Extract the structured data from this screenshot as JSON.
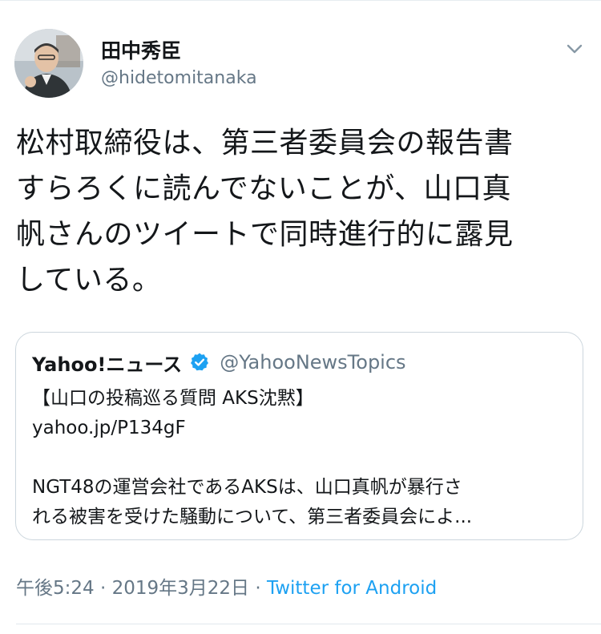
{
  "author": {
    "name": "田中秀臣",
    "handle": "@hidetomitanaka"
  },
  "tweet": {
    "lines": [
      "松村取締役は、第三者委員会の報告書",
      "すらろくに読んでないことが、山口真",
      "帆さんのツイートで同時進行的に露見",
      "している。"
    ]
  },
  "quote": {
    "name": "Yahoo!ニュース",
    "handle": "@YahooNewsTopics",
    "line1": "【山口の投稿巡る質問 AKS沈黙】",
    "link": "yahoo.jp/P134gF",
    "line3": "NGT48の運営会社であるAKSは、山口真帆が暴行さ",
    "line4": "れる被害を受けた騒動について、第三者委員会によ..."
  },
  "meta": {
    "time": "午後5:24",
    "separator1": " · ",
    "date": "2019年3月22日",
    "separator2": " · ",
    "app": "Twitter for Android"
  },
  "icons": {
    "more": "chevron-down-icon",
    "verified": "verified-badge-icon"
  },
  "colors": {
    "accent": "#1da1f2",
    "secondary_text": "#657786",
    "border": "#ccd6dd"
  }
}
